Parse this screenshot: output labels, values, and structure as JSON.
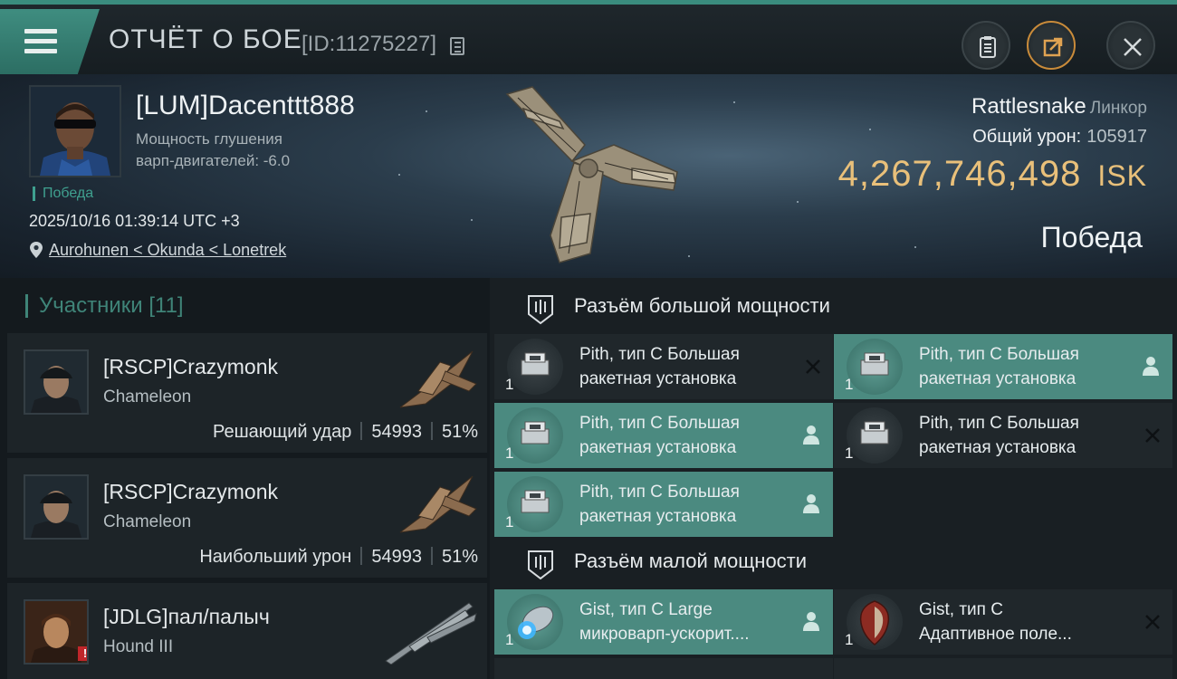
{
  "header": {
    "title": "ОТЧЁТ О БОЕ",
    "report_id": "[ID:11275227]"
  },
  "hero": {
    "pilot_name": "[LUM]Dacenttt888",
    "warp_label_1": "Мощность глушения",
    "warp_label_2": "варп-двигателей: -6.0",
    "status_small": "Победа",
    "datetime": "2025/10/16 01:39:14 UTC +3",
    "location": "Aurohunen < Okunda < Lonetrek",
    "ship_name": "Rattlesnake",
    "ship_class": "Линкор",
    "total_damage_label": "Общий урон:",
    "total_damage_value": "105917",
    "isk_value": "4,267,746,498",
    "isk_unit": "ISK",
    "status_big": "Победа"
  },
  "participants": {
    "title": "Участники",
    "count": "[11]",
    "items": [
      {
        "name": "[RSCP]Crazymonk",
        "ship": "Chameleon",
        "role": "Решающий удар",
        "damage": "54993",
        "percent": "51%"
      },
      {
        "name": "[RSCP]Crazymonk",
        "ship": "Chameleon",
        "role": "Наибольший урон",
        "damage": "54993",
        "percent": "51%"
      },
      {
        "name": "[JDLG]пал/палыч",
        "ship": "Hound III"
      }
    ]
  },
  "slots": {
    "high": {
      "title": "Разъём большой мощности",
      "modules": [
        {
          "line1": "Pith, тип C Большая",
          "line2": "ракетная установка",
          "qty": "1",
          "state": "destroyed"
        },
        {
          "line1": "Pith, тип C Большая",
          "line2": "ракетная установка",
          "qty": "1",
          "state": "dropped"
        },
        {
          "line1": "Pith, тип C Большая",
          "line2": "ракетная установка",
          "qty": "1",
          "state": "dropped"
        },
        {
          "line1": "Pith, тип C Большая",
          "line2": "ракетная установка",
          "qty": "1",
          "state": "destroyed"
        },
        {
          "line1": "Pith, тип C Большая",
          "line2": "ракетная установка",
          "qty": "1",
          "state": "dropped"
        }
      ]
    },
    "low": {
      "title": "Разъём малой мощности",
      "modules": [
        {
          "line1": "Gist, тип C Large",
          "line2": "микроварп-ускорит....",
          "qty": "1",
          "state": "dropped"
        },
        {
          "line1": "Gist, тип C",
          "line2": "Адаптивное поле...",
          "qty": "1",
          "state": "destroyed"
        }
      ]
    }
  },
  "colors": {
    "accent": "#3f8d80",
    "isk": "#e9c07a",
    "dropped_bg": "#4b8a80",
    "destroyed_bg": "#20272b"
  }
}
